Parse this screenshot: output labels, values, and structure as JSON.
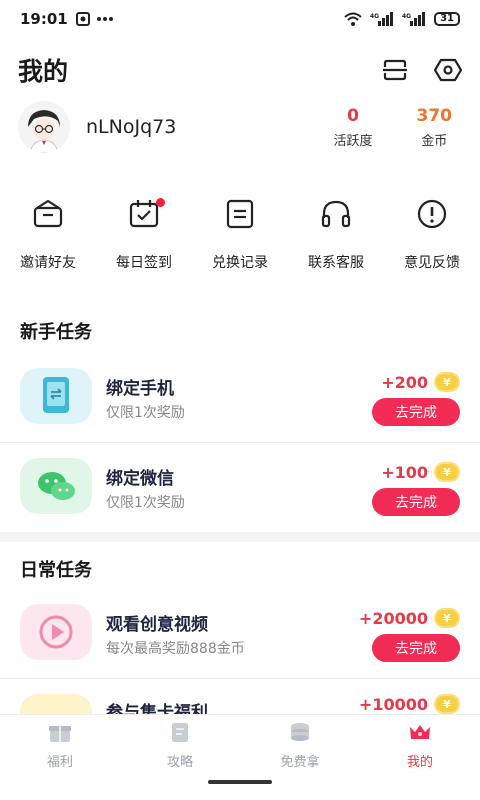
{
  "status_bar": {
    "time": "19:01",
    "battery": "31",
    "network_1": "4G",
    "network_2": "4G"
  },
  "header": {
    "title": "我的"
  },
  "profile": {
    "username": "nLNoJq73",
    "stats": [
      {
        "value": "0",
        "label": "活跃度",
        "color": "#e53a4a"
      },
      {
        "value": "370",
        "label": "金币",
        "color": "#f0742c"
      }
    ]
  },
  "quick_menu": [
    {
      "label": "邀请好友",
      "icon": "invite-icon"
    },
    {
      "label": "每日签到",
      "icon": "calendar-check-icon",
      "dot": true
    },
    {
      "label": "兑换记录",
      "icon": "list-record-icon"
    },
    {
      "label": "联系客服",
      "icon": "headphones-icon"
    },
    {
      "label": "意见反馈",
      "icon": "alert-circle-icon"
    }
  ],
  "newbie": {
    "title": "新手任务",
    "tasks": [
      {
        "title": "绑定手机",
        "subtitle": "仅限1次奖励",
        "reward": "+200",
        "button": "去完成",
        "icon": "phone-bind-icon"
      },
      {
        "title": "绑定微信",
        "subtitle": "仅限1次奖励",
        "reward": "+100",
        "button": "去完成",
        "icon": "wechat-icon"
      }
    ]
  },
  "daily": {
    "title": "日常任务",
    "tasks": [
      {
        "title": "观看创意视频",
        "subtitle": "每次最高奖励888金币",
        "reward": "+20000",
        "button": "去完成",
        "icon": "play-video-icon"
      },
      {
        "title": "参与集卡福利",
        "subtitle": "",
        "reward": "+10000",
        "button": "",
        "icon": "card-icon"
      }
    ]
  },
  "coin_symbol": "¥",
  "tabbar": {
    "tabs": [
      {
        "label": "福利",
        "icon": "gift-icon",
        "active": false
      },
      {
        "label": "攻略",
        "icon": "guide-icon",
        "active": false
      },
      {
        "label": "免费拿",
        "icon": "coins-icon",
        "active": false
      },
      {
        "label": "我的",
        "icon": "crown-icon",
        "active": true
      }
    ]
  },
  "colors": {
    "accent": "#f22c55",
    "reward": "#e53a4a",
    "coin": "#f6cf44"
  }
}
